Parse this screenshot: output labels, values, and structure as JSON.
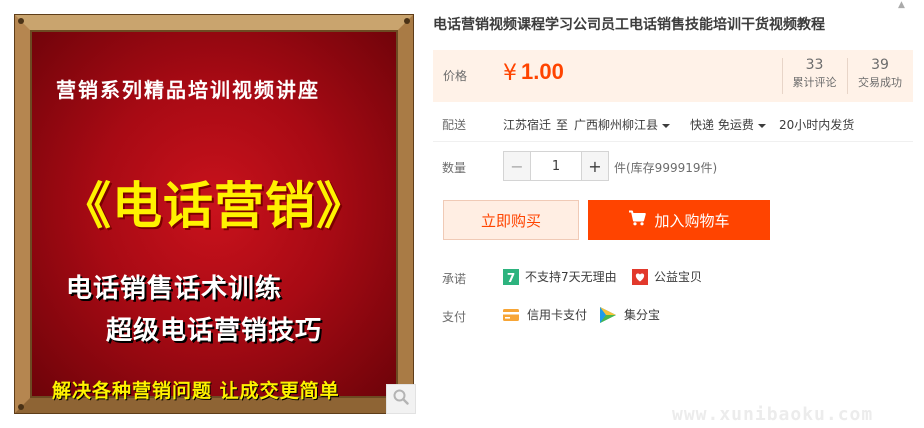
{
  "product_image": {
    "line1": "营销系列精品培训视频讲座",
    "line2": "《电话营销》",
    "line3": "电话销售话术训练",
    "line4": "超级电话营销技巧",
    "line5": "解决各种营销问题  让成交更简单",
    "zoom_icon": "search-icon"
  },
  "title": "电话营销视频课程学习公司员工电话销售技能培训干货视频教程",
  "price": {
    "label": "价格",
    "currency": "¥",
    "value": "1.00",
    "reviews_count": "33",
    "reviews_label": "累计评论",
    "trades_count": "39",
    "trades_label": "交易成功",
    "accent_color": "#ff4400"
  },
  "shipping": {
    "label": "配送",
    "from": "江苏宿迁",
    "to_word": "至",
    "destination": "广西柳州柳江县",
    "method": "快递 免运费",
    "dispatch": "20小时内发货"
  },
  "quantity": {
    "label": "数量",
    "minus": "−",
    "value": "1",
    "plus": "+",
    "stock": "件(库存999919件)"
  },
  "actions": {
    "buy_now": "立即购买",
    "add_to_cart": "加入购物车"
  },
  "promise": {
    "label": "承诺",
    "items": [
      {
        "icon": "seven-day-icon",
        "text": "不支持7天无理由"
      },
      {
        "icon": "charity-icon",
        "text": "公益宝贝"
      }
    ]
  },
  "payment": {
    "label": "支付",
    "items": [
      {
        "icon": "credit-card-icon",
        "text": "信用卡支付"
      },
      {
        "icon": "jifenbao-icon",
        "text": "集分宝"
      }
    ]
  },
  "watermark": "www.xunibaoku.com"
}
